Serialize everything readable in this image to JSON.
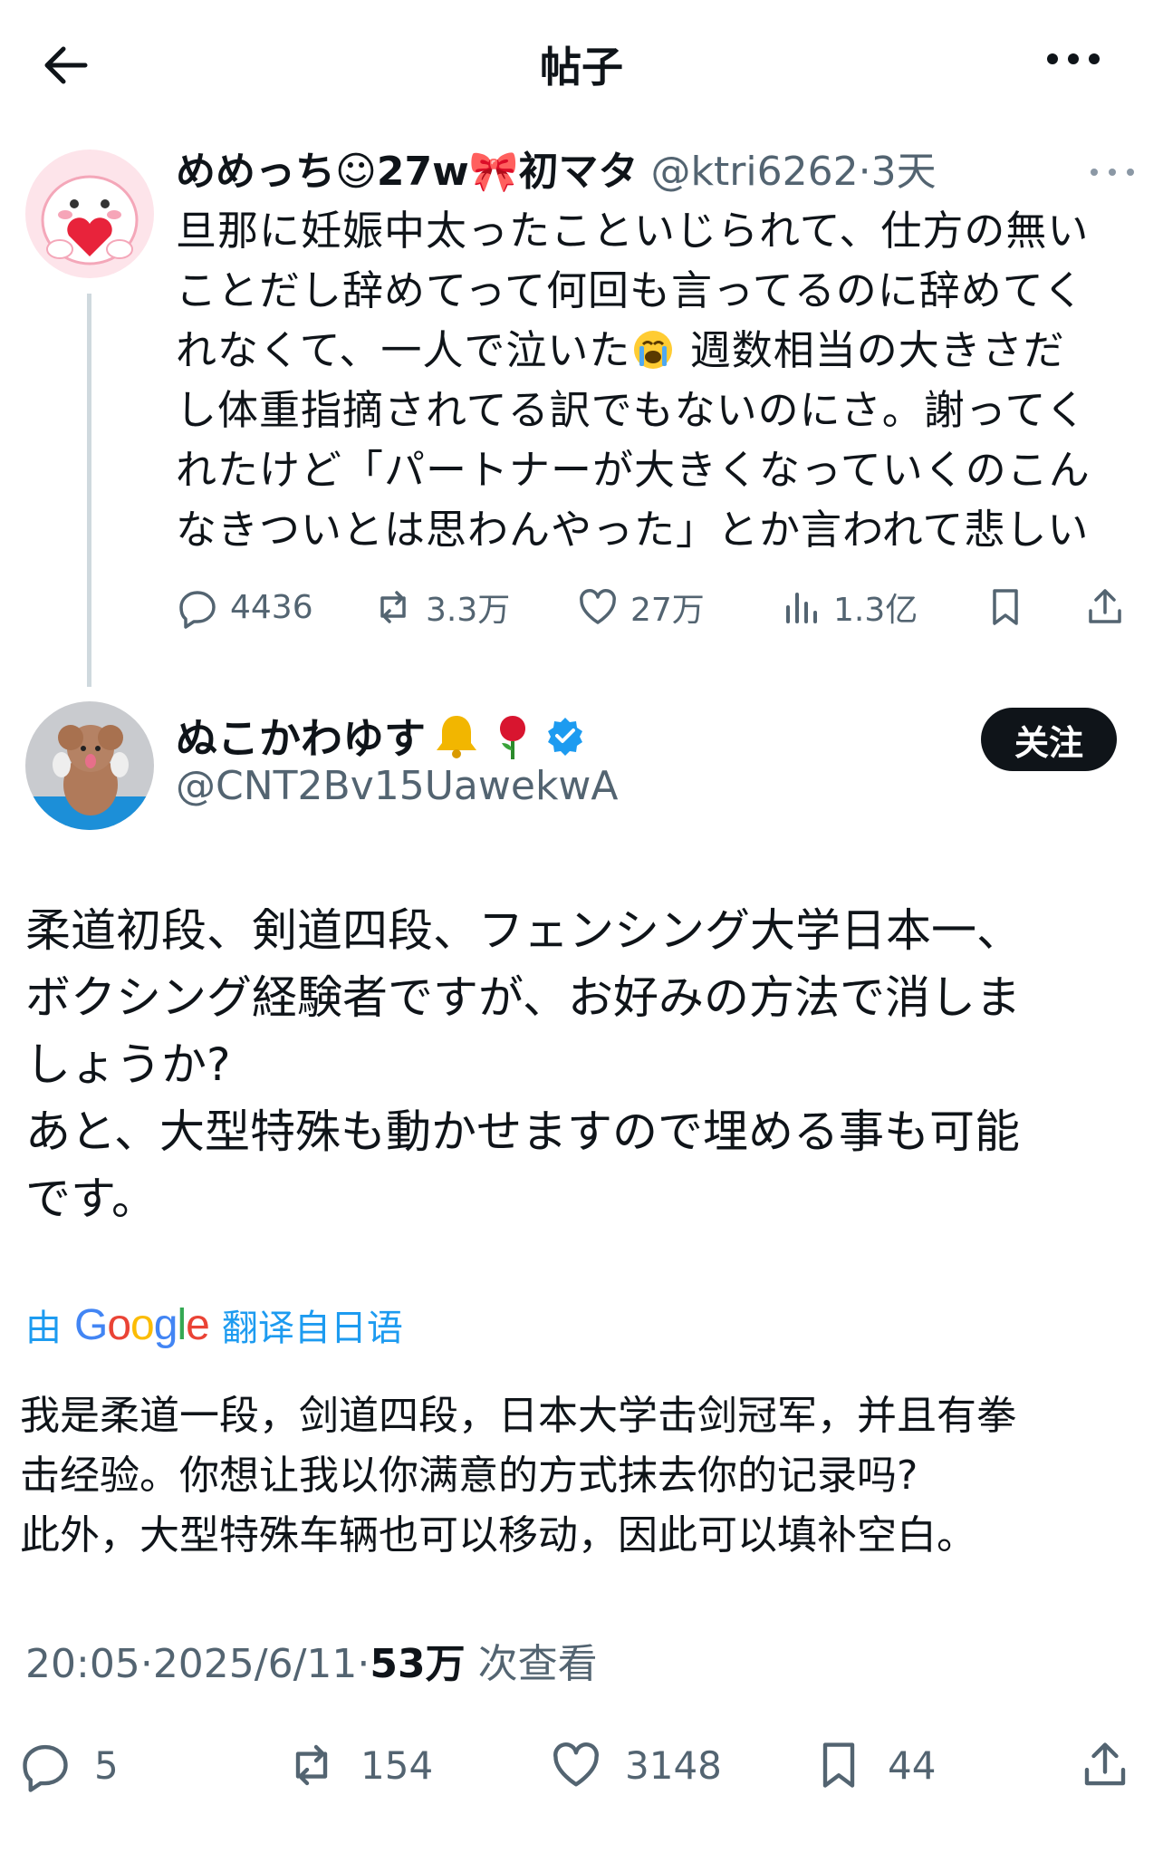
{
  "header": {
    "title": "帖子"
  },
  "parent_post": {
    "name": "めめっち☺27w🎀初マタ",
    "handle": "@ktri6262",
    "dot": "·",
    "time": "3天",
    "lines": [
      "旦那に妊娠中太ったこといじられて、仕方の無い",
      "ことだし辞めてって何回も言ってるのに辞めてく",
      "れなくて、一人で泣いた",
      "週数相当の大きさだ",
      "し体重指摘されてる訳でもないのにさ。謝ってく",
      "れたけど「パートナーが大きくなっていくのこん",
      "なきついとは思わんやった」とか言われて悲しい"
    ],
    "emoji_icon": "loudly-crying-face-icon",
    "actions": {
      "replies": "4436",
      "reposts": "3.3万",
      "likes": "27万",
      "views": "1.3亿"
    }
  },
  "main_post": {
    "name": "ぬこかわゆす",
    "name_icons": [
      "bell-icon",
      "rose-icon",
      "verified-badge-icon"
    ],
    "handle": "@CNT2Bv15UawekwA",
    "follow_label": "关注",
    "lines": [
      "柔道初段、剣道四段、フェンシング大学日本一、",
      "ボクシング経験者ですが、お好みの方法で消しま",
      "しょうか?",
      "あと、大型特殊も動かせますので埋める事も可能",
      "です。"
    ],
    "translation": {
      "prefix": "由",
      "provider": "Google",
      "suffix": "翻译自日语",
      "lines": [
        "我是柔道一段，剑道四段，日本大学击剑冠军，并且有拳",
        "击经验。你想让我以你满意的方式抹去你的记录吗?",
        "此外，大型特殊车辆也可以移动，因此可以填补空白。"
      ]
    },
    "meta": {
      "time": "20:05",
      "sep1": "·",
      "date": "2025/6/11",
      "sep2": "·",
      "views": "53万",
      "views_label": "次查看"
    },
    "actions": {
      "replies": "5",
      "reposts": "154",
      "likes": "3148",
      "bookmarks": "44"
    }
  },
  "colors": {
    "text": "#0f1419",
    "secondary": "#536471",
    "link": "#1d9bf0",
    "divider": "#cfd9de",
    "verified": "#1d9bf0"
  }
}
